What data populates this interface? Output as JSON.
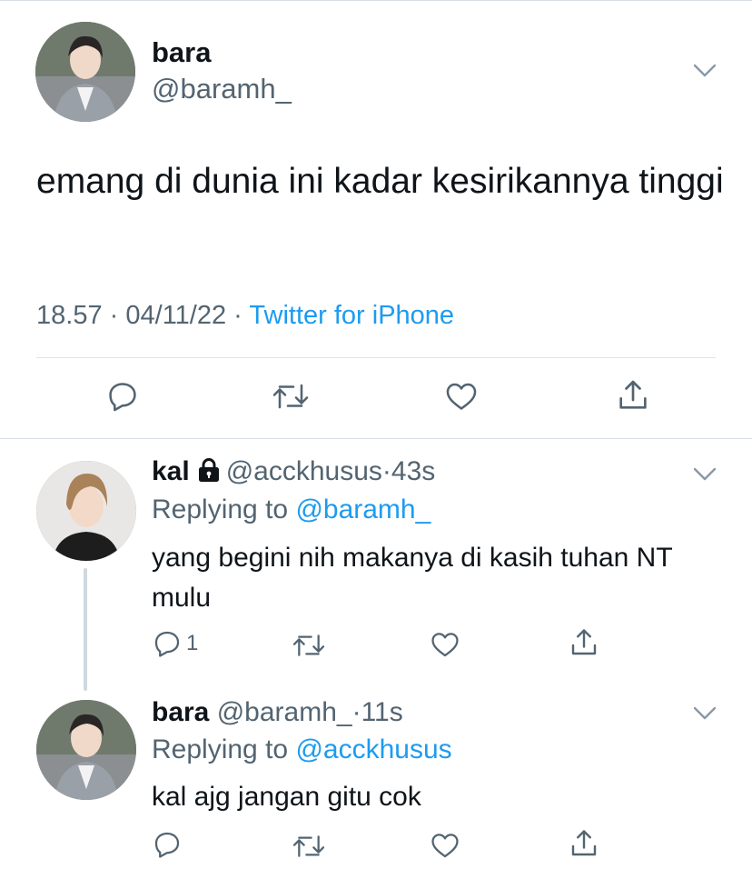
{
  "main_tweet": {
    "name": "bara",
    "handle": "@baramh_",
    "text": "emang di dunia ini kadar kesirikannya tinggi",
    "time": "18.57",
    "date": "04/11/22",
    "separator": "·",
    "source": "Twitter for iPhone"
  },
  "replies": [
    {
      "name": "kal",
      "handle": "@acckhusus",
      "dot": "·",
      "age": "43s",
      "replying_prefix": "Replying to ",
      "replying_to": "@baramh_",
      "text": "yang begini nih makanya di kasih tuhan NT mulu",
      "reply_count": "1",
      "locked": true
    },
    {
      "name": "bara",
      "handle": "@baramh_",
      "dot": "·",
      "age": "11s",
      "replying_prefix": "Replying to ",
      "replying_to": "@acckhusus",
      "text": "kal ajg jangan gitu cok",
      "reply_count": ""
    }
  ],
  "colors": {
    "link": "#1d9bf0",
    "secondary_text": "#536471",
    "primary_text": "#0f1419",
    "divider": "#d7dde2"
  },
  "icons": [
    "chevron-down-icon",
    "reply-icon",
    "retweet-icon",
    "like-icon",
    "share-icon",
    "lock-icon"
  ]
}
